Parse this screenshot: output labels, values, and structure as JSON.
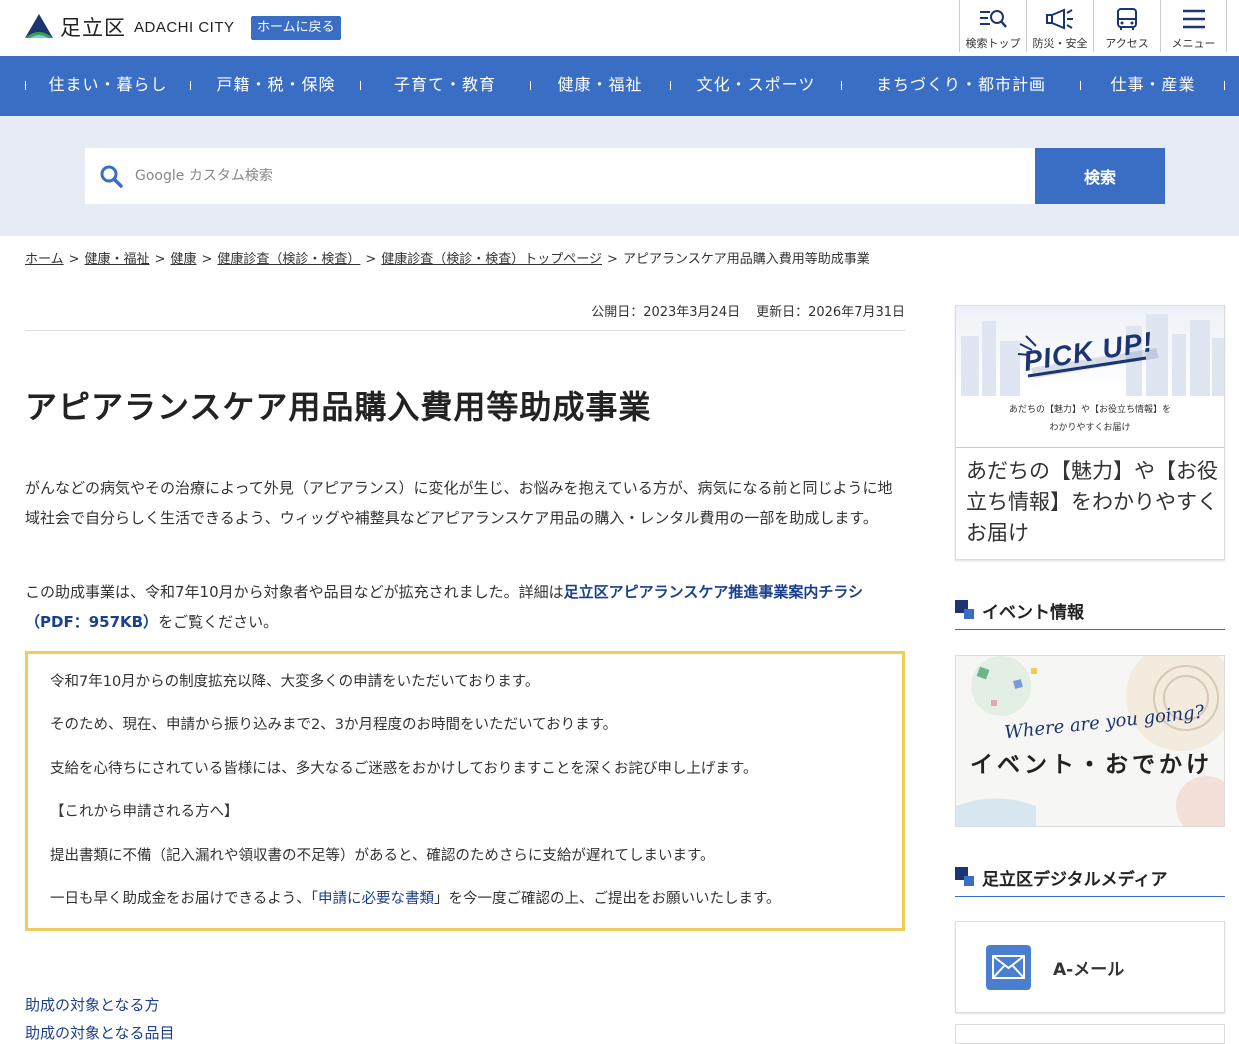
{
  "header": {
    "logo_ja": "足立区",
    "logo_en": "ADACHI CITY",
    "home_button": "ホームに戻る",
    "nav": [
      {
        "label": "検索トップ",
        "icon": "search-top-icon"
      },
      {
        "label": "防災・安全",
        "icon": "megaphone-icon"
      },
      {
        "label": "アクセス",
        "icon": "bus-icon"
      },
      {
        "label": "メニュー",
        "icon": "hamburger-menu-icon"
      }
    ]
  },
  "global_nav": [
    "住まい・暮らし",
    "戸籍・税・保険",
    "子育て・教育",
    "健康・福祉",
    "文化・スポーツ",
    "まちづくり・都市計画",
    "仕事・産業"
  ],
  "search": {
    "placeholder": "Google カスタム検索",
    "button": "検索"
  },
  "breadcrumb": [
    {
      "label": "ホーム",
      "link": true
    },
    {
      "label": "健康・福祉",
      "link": true
    },
    {
      "label": "健康",
      "link": true
    },
    {
      "label": "健康診査（検診・検査）",
      "link": true
    },
    {
      "label": "健康診査（検診・検査）トップページ",
      "link": true
    },
    {
      "label": "アピアランスケア用品購入費用等助成事業",
      "link": false
    }
  ],
  "article": {
    "published": "公開日：2023年3月24日",
    "updated": "更新日：2026年7月31日",
    "title": "アピアランスケア用品購入費用等助成事業",
    "intro": "がんなどの病気やその治療によって外見（アピアランス）に変化が生じ、お悩みを抱えている方が、病気になる前と同じように地域社会で自分らしく生活できるよう、ウィッグや補整具などアピアランスケア用品の購入・レンタル費用の一部を助成します。",
    "para2_before": "この助成事業は、令和7年10月から対象者や品目などが拡充されました。詳細は",
    "para2_link": "足立区アピアランスケア推進事業案内チラシ（PDF：957KB）",
    "para2_after": "をご覧ください。",
    "notice": {
      "line1": "令和7年10月からの制度拡充以降、大変多くの申請をいただいております。",
      "line2": "そのため、現在、申請から振り込みまで2、3か月程度のお時間をいただいております。",
      "line3": "支給を心待ちにされている皆様には、多大なるご迷惑をおかけしておりますことを深くお詫び申し上げます。",
      "line4": "【これから申請される方へ】",
      "line5": "提出書類に不備（記入漏れや領収書の不足等）があると、確認のためさらに支給が遅れてしまいます。",
      "line6_before": "一日も早く助成金をお届けできるよう、「",
      "line6_link": "申請に必要な書類",
      "line6_after": "」を今一度ご確認の上、ご提出をお願いいたします。"
    },
    "toc": [
      "助成の対象となる方",
      "助成の対象となる品目"
    ]
  },
  "sidebar": {
    "pickup": {
      "title": "PICK UP!",
      "line1": "あだちの【魅力】や【お役立ち情報】を",
      "line2": "わかりやすくお届け",
      "caption": "あだちの【魅力】や【お役立ち情報】をわかりやすくお届け"
    },
    "events_heading": "イベント情報",
    "event_banner": {
      "where": "Where are you going?",
      "main": "イベント・おでかけ"
    },
    "digital_heading": "足立区デジタルメディア",
    "amail": "A-メール"
  },
  "colors": {
    "brand_blue": "#3a6dc4",
    "navy": "#1c3570",
    "notice_border": "#f2cc5b",
    "search_band": "#e6ebf4"
  }
}
